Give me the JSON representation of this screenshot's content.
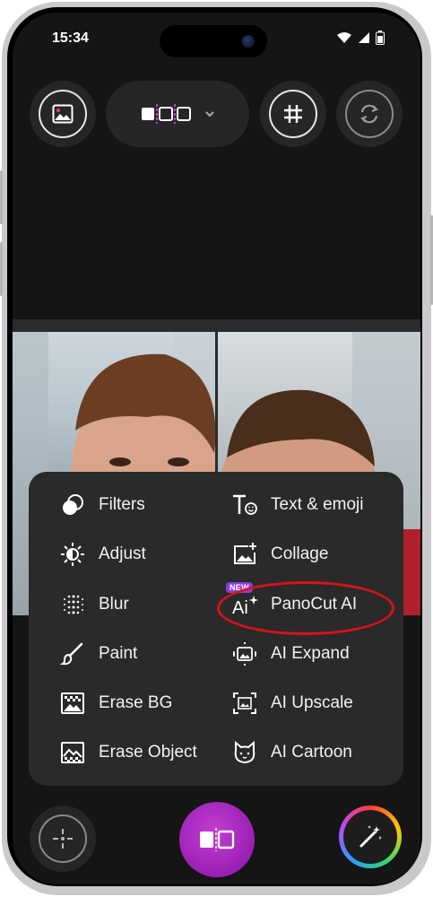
{
  "status_bar": {
    "time": "15:34"
  },
  "topbar": {
    "gallery_icon": "image-icon",
    "layout_icon": "three-panel-layout-icon",
    "grid_icon": "hashtag-grid-icon",
    "rotate_icon": "rotate-icon"
  },
  "menu": {
    "left": [
      {
        "label": "Filters",
        "icon": "filters-icon"
      },
      {
        "label": "Adjust",
        "icon": "brightness-icon"
      },
      {
        "label": "Blur",
        "icon": "blur-dots-icon"
      },
      {
        "label": "Paint",
        "icon": "brush-icon"
      },
      {
        "label": "Erase BG",
        "icon": "erase-bg-icon"
      },
      {
        "label": "Erase Object",
        "icon": "erase-object-icon"
      }
    ],
    "right": [
      {
        "label": "Text & emoji",
        "icon": "text-emoji-icon"
      },
      {
        "label": "Collage",
        "icon": "collage-icon"
      },
      {
        "label": "PanoCut AI",
        "icon": "ai-sparkle-icon",
        "badge": "NEW"
      },
      {
        "label": "AI Expand",
        "icon": "ai-expand-icon"
      },
      {
        "label": "AI Upscale",
        "icon": "ai-upscale-icon"
      },
      {
        "label": "AI Cartoon",
        "icon": "cat-face-icon"
      }
    ],
    "highlight_color": "#d6121a"
  },
  "colors": {
    "accent": "#9b1fb5",
    "badge": "#8b3fd9",
    "background": "#151515",
    "menu_bg": "#2a2a2a"
  }
}
